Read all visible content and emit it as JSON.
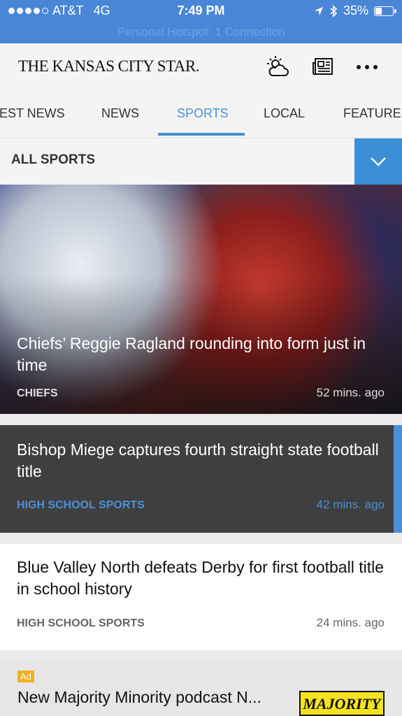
{
  "status_bar": {
    "carrier": "AT&T",
    "network": "4G",
    "time": "7:49 PM",
    "battery": "35%",
    "hotspot": "Personal Hotspot: 1 Connection"
  },
  "header": {
    "logo": "THE KANSAS CITY STAR.",
    "icons": [
      "weather-icon",
      "newspaper-icon",
      "more-icon"
    ]
  },
  "tabs": [
    {
      "label": "TEST NEWS"
    },
    {
      "label": "NEWS"
    },
    {
      "label": "SPORTS",
      "active": true
    },
    {
      "label": "LOCAL"
    },
    {
      "label": "FEATURED"
    }
  ],
  "filter": {
    "label": "ALL SPORTS"
  },
  "articles": [
    {
      "title": "Chiefs’ Reggie Ragland rounding into form just in time",
      "category": "CHIEFS",
      "time": "52 mins. ago"
    },
    {
      "title": "Bishop Miege captures fourth straight state football title",
      "category": "HIGH SCHOOL SPORTS",
      "time": "42 mins. ago"
    },
    {
      "title": "Blue Valley North defeats Derby for first football title in school history",
      "category": "HIGH SCHOOL SPORTS",
      "time": "24 mins. ago"
    }
  ],
  "ad": {
    "badge": "Ad",
    "title": "New Majority Minority podcast N...",
    "thumb_text": "MAJORITY"
  },
  "colors": {
    "status_bar": "#4a86d8",
    "accent": "#4a90d9",
    "dark_card": "#3f3f3f",
    "ad_badge": "#f2b01e"
  }
}
